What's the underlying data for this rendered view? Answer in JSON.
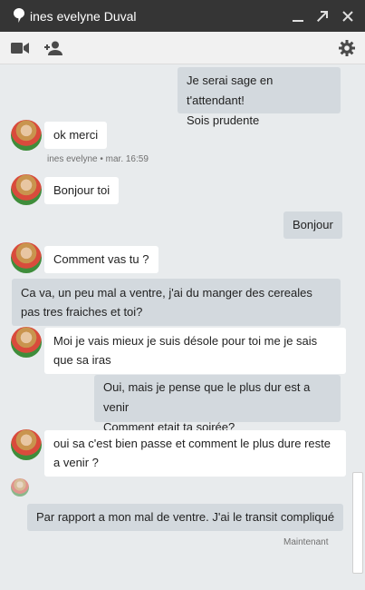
{
  "window": {
    "title": "ines evelyne Duval",
    "icons": [
      "chat-bubble-icon",
      "minimize-icon",
      "popout-icon",
      "close-icon"
    ]
  },
  "toolbar": {
    "icons": [
      "video-camera-icon",
      "add-person-icon",
      "gear-icon"
    ]
  },
  "messages": [
    {
      "dir": "out",
      "text": "Je serai sage en t'attendant!"
    },
    {
      "dir": "out",
      "text": "Sois prudente"
    },
    {
      "dir": "in",
      "text": "ok merci"
    },
    {
      "dir": "in",
      "text": "Bonjour toi"
    },
    {
      "dir": "out",
      "text": "Bonjour"
    },
    {
      "dir": "in",
      "text": "Comment vas tu ?"
    },
    {
      "dir": "out",
      "text": "Ca va, un peu mal a ventre, j'ai du manger des cereales pas tres fraiches et toi?"
    },
    {
      "dir": "in",
      "text": "Moi je vais mieux je suis désole pour toi me je sais que sa iras"
    },
    {
      "dir": "out",
      "text": "Oui, mais je pense que le plus dur est a venir"
    },
    {
      "dir": "out",
      "text": "Comment etait ta soirée?"
    },
    {
      "dir": "in",
      "text": "oui sa c'est bien passe et comment le plus dure reste a venir ?"
    },
    {
      "dir": "out",
      "text": "Par rapport a mon mal de ventre. J'ai le transit compliqué"
    }
  ],
  "meta": {
    "sender_time": "ines evelyne • mar. 16:59",
    "last_status": "Maintenant"
  }
}
